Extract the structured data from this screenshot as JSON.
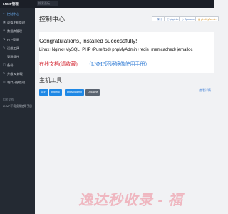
{
  "topbar": {
    "brand": "LNMP管理",
    "search_placeholder": "搜索面板"
  },
  "sidebar": {
    "items": [
      {
        "label": "控制中心",
        "icon": "home-icon",
        "active": true
      },
      {
        "label": "虚拟主机管理",
        "icon": "server-icon"
      },
      {
        "label": "数据库管理",
        "icon": "database-icon"
      },
      {
        "label": "FTP管理",
        "icon": "ftp-icon"
      },
      {
        "label": "运维工具",
        "icon": "tools-icon"
      },
      {
        "label": "管理插件",
        "icon": "plugin-icon"
      },
      {
        "label": "备份",
        "icon": "backup-icon"
      },
      {
        "label": "升级 & 卸载",
        "icon": "upgrade-icon"
      },
      {
        "label": "端口开放管理",
        "icon": "port-icon"
      }
    ],
    "section_label": "相关文档",
    "note": "LNMP环境镜像使用手册"
  },
  "main": {
    "title": "控制中心",
    "header_buttons": [
      {
        "label": "探针",
        "icon": "probe-icon"
      },
      {
        "label": "phpinfo",
        "icon": "info-icon"
      },
      {
        "label": "Opcache",
        "icon": "cache-icon"
      },
      {
        "label": "phpMyAdmin",
        "icon": "db-icon"
      }
    ],
    "congrats": "Congratulations, installed successfully!",
    "components": "Linux+Nginx+MySQL+PHP+Pureftpd+phpMyAdmin+redis+memcached+jemalloc",
    "doc_link": "在线文档(请收藏):",
    "doc_manual": "（LNMP环境镜像使用手册）",
    "tools_title": "主机工具",
    "tools": [
      {
        "label": "探针",
        "color": "#1e88e5"
      },
      {
        "label": "phpinfo",
        "color": "#1e88e5"
      },
      {
        "label": "phpMyAdmin",
        "color": "#1e88e5"
      },
      {
        "label": "Opcache",
        "color": "#5b6470"
      }
    ],
    "detail_link": "查看详情"
  },
  "watermark": "逸达秒收录 - 福"
}
